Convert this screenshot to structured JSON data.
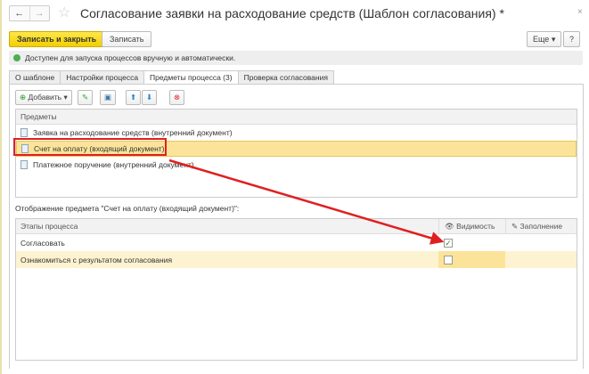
{
  "window": {
    "title": "Согласование заявки на расходование средств (Шаблон согласования) *",
    "back": "←",
    "forward": "→",
    "close": "×"
  },
  "toolbar": {
    "save_close": "Записать и закрыть",
    "save": "Записать",
    "more": "Еще ▾",
    "help": "?"
  },
  "status": {
    "text": "Доступен для запуска процессов вручную и автоматически.",
    "color": "#4caf50"
  },
  "tabs": [
    "О шаблоне",
    "Настройки процесса",
    "Предметы процесса (3)",
    "Проверка согласования"
  ],
  "subjects": {
    "add": "Добавить",
    "header": "Предметы",
    "items": [
      "Заявка на расходование средств (внутренний документ)",
      "Счет на оплату (входящий документ)",
      "Платежное поручение (внутренний документ)"
    ]
  },
  "display": {
    "label": "Отображение предмета \"Счет на оплату (входящий документ)\":",
    "col_stage": "Этапы процесса",
    "col_visible": "Видимость",
    "col_fill": "Заполнение",
    "rows": [
      {
        "stage": "Согласовать",
        "visible": true
      },
      {
        "stage": "Ознакомиться с результатом согласования",
        "visible": false
      }
    ]
  },
  "annotation_color": "#e02020"
}
